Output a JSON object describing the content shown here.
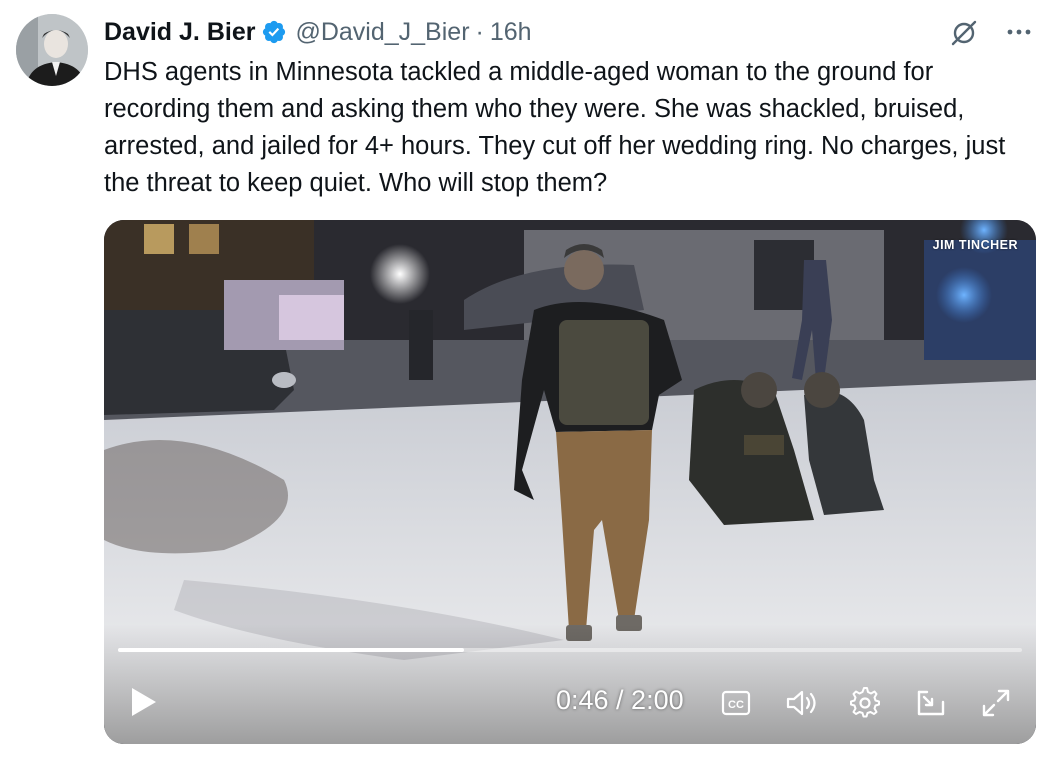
{
  "author": {
    "name": "David J. Bier",
    "handle": "@David_J_Bier",
    "separator": "·",
    "time": "16h",
    "verified": true
  },
  "tweet_text": "DHS agents in Minnesota tackled a middle-aged woman to the ground for recording them and asking them who they were. She was shackled, bruised, arrested, and jailed for 4+ hours. They cut off her wedding ring. No charges, just the threat to keep quiet. Who will stop them?",
  "video": {
    "watermark": "JIM TINCHER",
    "timecode": "0:46 / 2:00",
    "progress": 0.383,
    "controls": [
      "play-icon",
      "closed-captions-icon",
      "volume-icon",
      "settings-gear-icon",
      "picture-in-picture-icon",
      "fullscreen-icon"
    ]
  },
  "actions": [
    "grok-icon",
    "more-options-icon"
  ],
  "colors": {
    "verified_blue": "#1d9bf0",
    "secondary_text": "#536471",
    "primary_text": "#0f1419"
  }
}
